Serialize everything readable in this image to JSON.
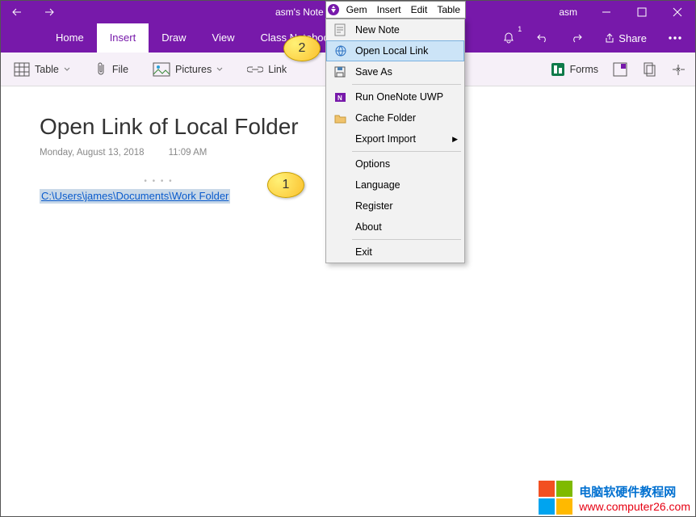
{
  "titlebar": {
    "title": "asm's Note",
    "user": "asm"
  },
  "tabs": {
    "home": "Home",
    "insert": "Insert",
    "draw": "Draw",
    "view": "View",
    "class": "Class Notebook"
  },
  "ribbon_right": {
    "bell_sup": "1",
    "share": "Share"
  },
  "ribbon": {
    "table": "Table",
    "file": "File",
    "pictures": "Pictures",
    "link": "Link",
    "forms": "Forms"
  },
  "page": {
    "title": "Open Link of Local Folder",
    "date": "Monday, August 13, 2018",
    "time": "11:09 AM",
    "link_text": "C:\\Users\\james\\Documents\\Work Folder"
  },
  "gem_bar": {
    "gem": "Gem",
    "insert": "Insert",
    "edit": "Edit",
    "table": "Table"
  },
  "menu": {
    "new_note": "New Note",
    "open_local_link": "Open Local Link",
    "save_as": "Save As",
    "run_uwp": "Run OneNote UWP",
    "cache_folder": "Cache Folder",
    "export_import": "Export Import",
    "options": "Options",
    "language": "Language",
    "register": "Register",
    "about": "About",
    "exit": "Exit"
  },
  "balloons": {
    "one": "1",
    "two": "2"
  },
  "watermark": {
    "line1": "电脑软硬件教程网",
    "line2": "www.computer26.com"
  }
}
